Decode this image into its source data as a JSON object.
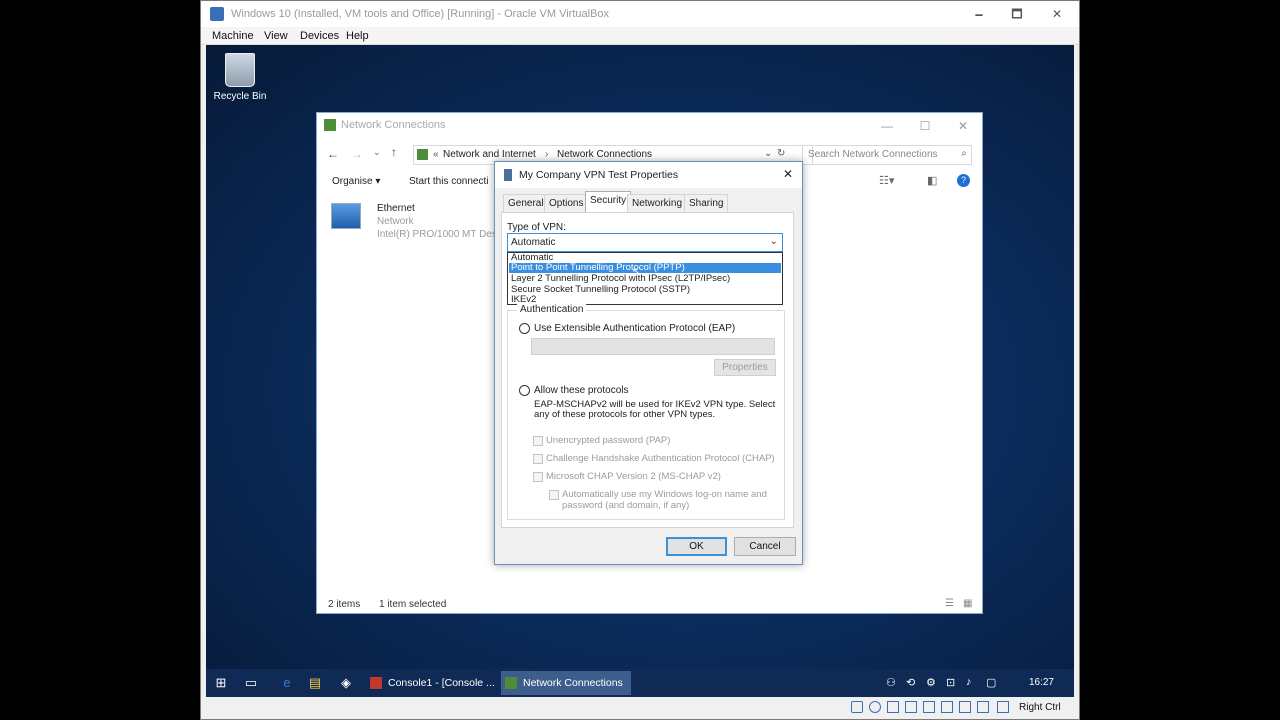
{
  "vbox": {
    "title": "Windows 10 (Installed, VM tools and Office) [Running] - Oracle VM VirtualBox",
    "menu": [
      "Machine",
      "View",
      "Devices",
      "Help"
    ],
    "controls": {
      "minimize": "🗕",
      "maximize": "🗖",
      "close": "✕"
    },
    "host_key": "Right Ctrl"
  },
  "desktop": {
    "recycle_bin": "Recycle Bin"
  },
  "explorer": {
    "title": "Network Connections",
    "breadcrumb": [
      "Network and Internet",
      "Network Connections"
    ],
    "search_placeholder": "Search Network Connections",
    "toolbar": {
      "organise": "Organise ▾",
      "start": "Start this connecti"
    },
    "item": {
      "name": "Ethernet",
      "type": "Network",
      "adapter": "Intel(R) PRO/1000 MT Desk"
    },
    "status": {
      "count": "2 items",
      "selected": "1 item selected"
    }
  },
  "dialog": {
    "title": "My Company VPN Test Properties",
    "tabs": [
      "General",
      "Options",
      "Security",
      "Networking",
      "Sharing"
    ],
    "active_tab": "Security",
    "vpn_type_label": "Type of VPN:",
    "vpn_type_value": "Automatic",
    "vpn_options": [
      "Automatic",
      "Point to Point Tunnelling Protocol (PPTP)",
      "Layer 2 Tunnelling Protocol with IPsec (L2TP/IPsec)",
      "Secure Socket Tunnelling Protocol (SSTP)",
      "IKEv2"
    ],
    "highlighted_option": "Point to Point Tunnelling Protocol (PPTP)",
    "auth": {
      "legend": "Authentication",
      "eap_radio": "Use Extensible Authentication Protocol (EAP)",
      "properties_button": "Properties",
      "allow_radio": "Allow these protocols",
      "note_line1": "EAP-MSCHAPv2 will be used for IKEv2 VPN type. Select",
      "note_line2": "any of these protocols for other VPN types.",
      "pap": "Unencrypted password (PAP)",
      "chap": "Challenge Handshake Authentication Protocol (CHAP)",
      "mschap": "Microsoft CHAP Version 2 (MS-CHAP v2)",
      "auto_logon_line1": "Automatically use my Windows log-on name and",
      "auto_logon_line2": "password (and domain, if any)"
    },
    "ok": "OK",
    "cancel": "Cancel"
  },
  "taskbar": {
    "tasks": [
      "Console1 - [Console ...",
      "Network Connections"
    ],
    "clock": "16:27"
  },
  "colors": {
    "accent": "#3b8fe0",
    "taskbar": "#0f2a55",
    "desktop": "#0b2d5e"
  }
}
